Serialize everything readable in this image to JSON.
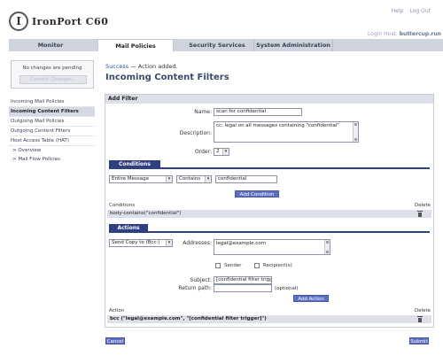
{
  "header": {
    "logo_letter": "I",
    "logo_text": "IronPort C60",
    "links": [
      "Help",
      "Log Out"
    ],
    "login_host_label": "Login Host:",
    "login_host_value": "buttercup.run"
  },
  "tabs": [
    {
      "label": "Monitor"
    },
    {
      "label": "Mail Policies"
    },
    {
      "label": "Security Services"
    },
    {
      "label": "System Administration"
    }
  ],
  "sidebar": {
    "pending_text": "No changes are pending",
    "commit_label": "Commit Changes...",
    "items": [
      {
        "label": "Incoming Mail Policies"
      },
      {
        "label": "Incoming Content Filters"
      },
      {
        "label": "Outgoing Mail Policies"
      },
      {
        "label": "Outgoing Content Filters"
      },
      {
        "label": "Host Access Table (HAT)"
      },
      {
        "label": "> Overview"
      },
      {
        "label": "> Mail Flow Policies"
      }
    ]
  },
  "main": {
    "success_word": "Success",
    "success_msg": " — Action added.",
    "page_title": "Incoming Content Filters",
    "panel_title": "Add Filter",
    "name_label": "Name:",
    "name_value": "scan for confidential",
    "description_label": "Description:",
    "description_value": "cc: legal on all messages containing \"confidential\"",
    "order_label": "Order:",
    "order_value": "2",
    "conditions_tab": "Conditions",
    "condition_scope": "Entire Message",
    "condition_op": "Contains",
    "condition_value": "confidential",
    "add_condition": "Add Condition",
    "conditions_header": "Conditions",
    "delete_header": "Delete",
    "condition_row": "body-contains(\"confidential\")",
    "actions_tab": "Actions",
    "action_type": "Send Copy to (Bcc:)",
    "addresses_label": "Addresses:",
    "addresses_value": "legal@example.com",
    "sender_label": "Sender",
    "recipients_label": "Recipient(s)",
    "subject_label": "Subject:",
    "subject_value": "[confidential filter trigg",
    "return_path_label": "Return path:",
    "optional_label": "(optional)",
    "add_action": "Add Action",
    "action_header": "Action",
    "action_row": "bcc (\"legal@example.com\", \"[confidential filter trigger]\")"
  },
  "footer": {
    "cancel": "Cancel",
    "submit": "Submit"
  },
  "colors": {
    "accent": "#2e3f82",
    "button": "#5e6ec3",
    "panel_head": "#dde0e8"
  }
}
